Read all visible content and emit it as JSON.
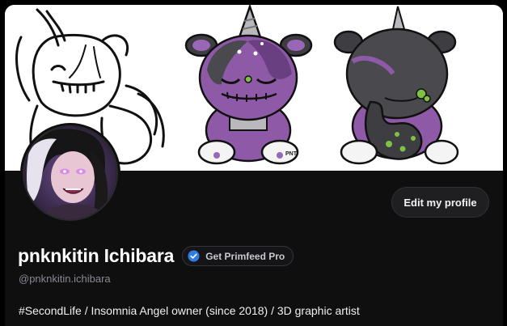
{
  "profile": {
    "display_name": "pnknkitin Ichibara",
    "handle": "@pnknkitin.ichibara",
    "bio": "#SecondLife / Insomnia Angel owner (since 2018) / 3D graphic artist",
    "edit_button_label": "Edit my profile",
    "pro_badge_label": "Get Primfeed Pro"
  },
  "banner": {
    "artwork_watermark": "PNT"
  },
  "icons": {
    "verified": "check-circle-icon"
  },
  "colors": {
    "background": "#0f0f10",
    "accent_blue": "#2f7de1",
    "button_bg": "#1f1f22",
    "creature_purple": "#8e5aa8",
    "creature_gray": "#4a4a4e",
    "creature_green": "#7fc243"
  }
}
